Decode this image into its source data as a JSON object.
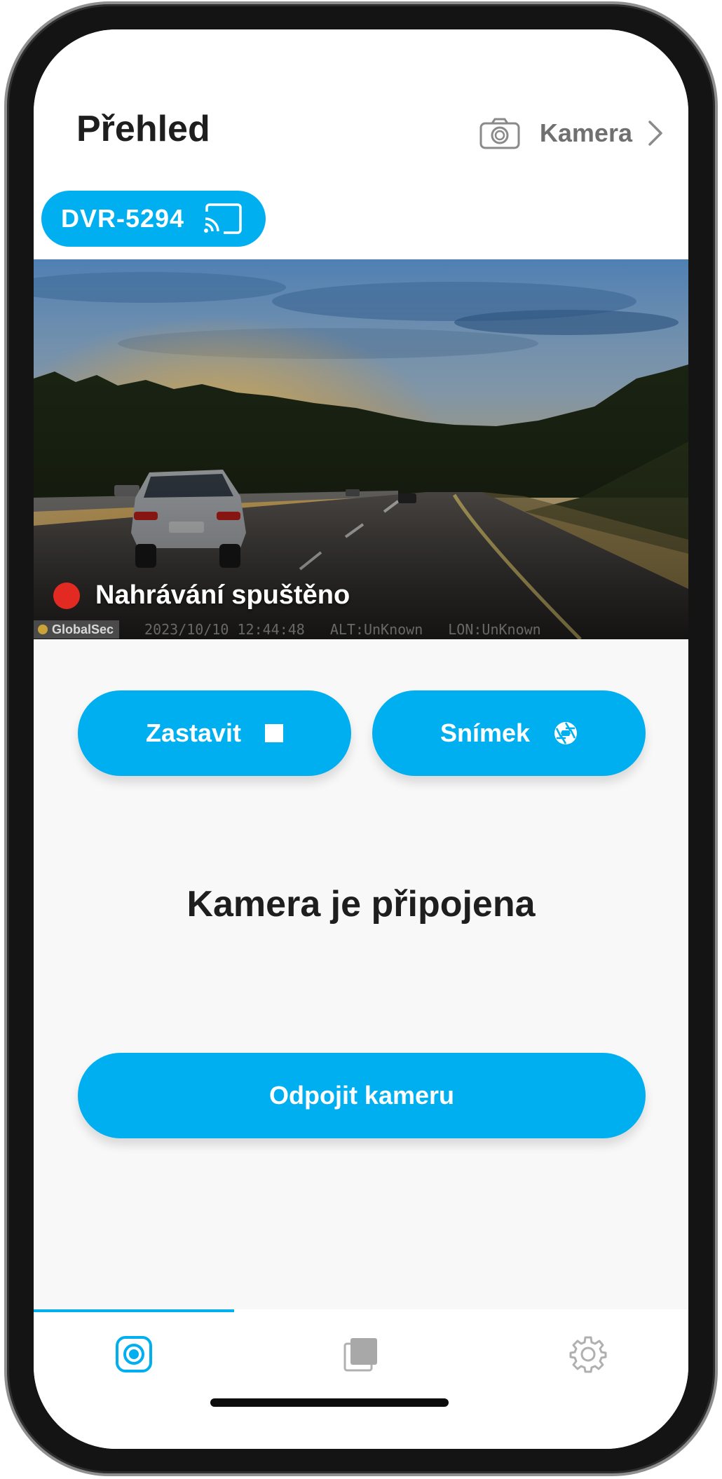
{
  "header": {
    "title": "Přehled",
    "camera_link_label": "Kamera"
  },
  "device": {
    "name": "DVR-5294"
  },
  "video": {
    "recording_status": "Nahrávání spuštěno",
    "brand": "GlobalSec",
    "overlay_datetime": "2023/10/10  12:44:48",
    "overlay_alt": "ALT:UnKnown",
    "overlay_lon": "LON:UnKnown"
  },
  "actions": {
    "stop_label": "Zastavit",
    "snapshot_label": "Snímek",
    "disconnect_label": "Odpojit kameru"
  },
  "status": {
    "connection_text": "Kamera je připojena"
  },
  "nav": {
    "tabs": [
      {
        "icon": "live-camera-icon",
        "active": true
      },
      {
        "icon": "gallery-icon",
        "active": false
      },
      {
        "icon": "settings-gear-icon",
        "active": false
      }
    ]
  },
  "colors": {
    "accent": "#00aff0",
    "recording_red": "#e32a22",
    "title_text": "#1e1e1e",
    "muted_text": "#707070"
  }
}
